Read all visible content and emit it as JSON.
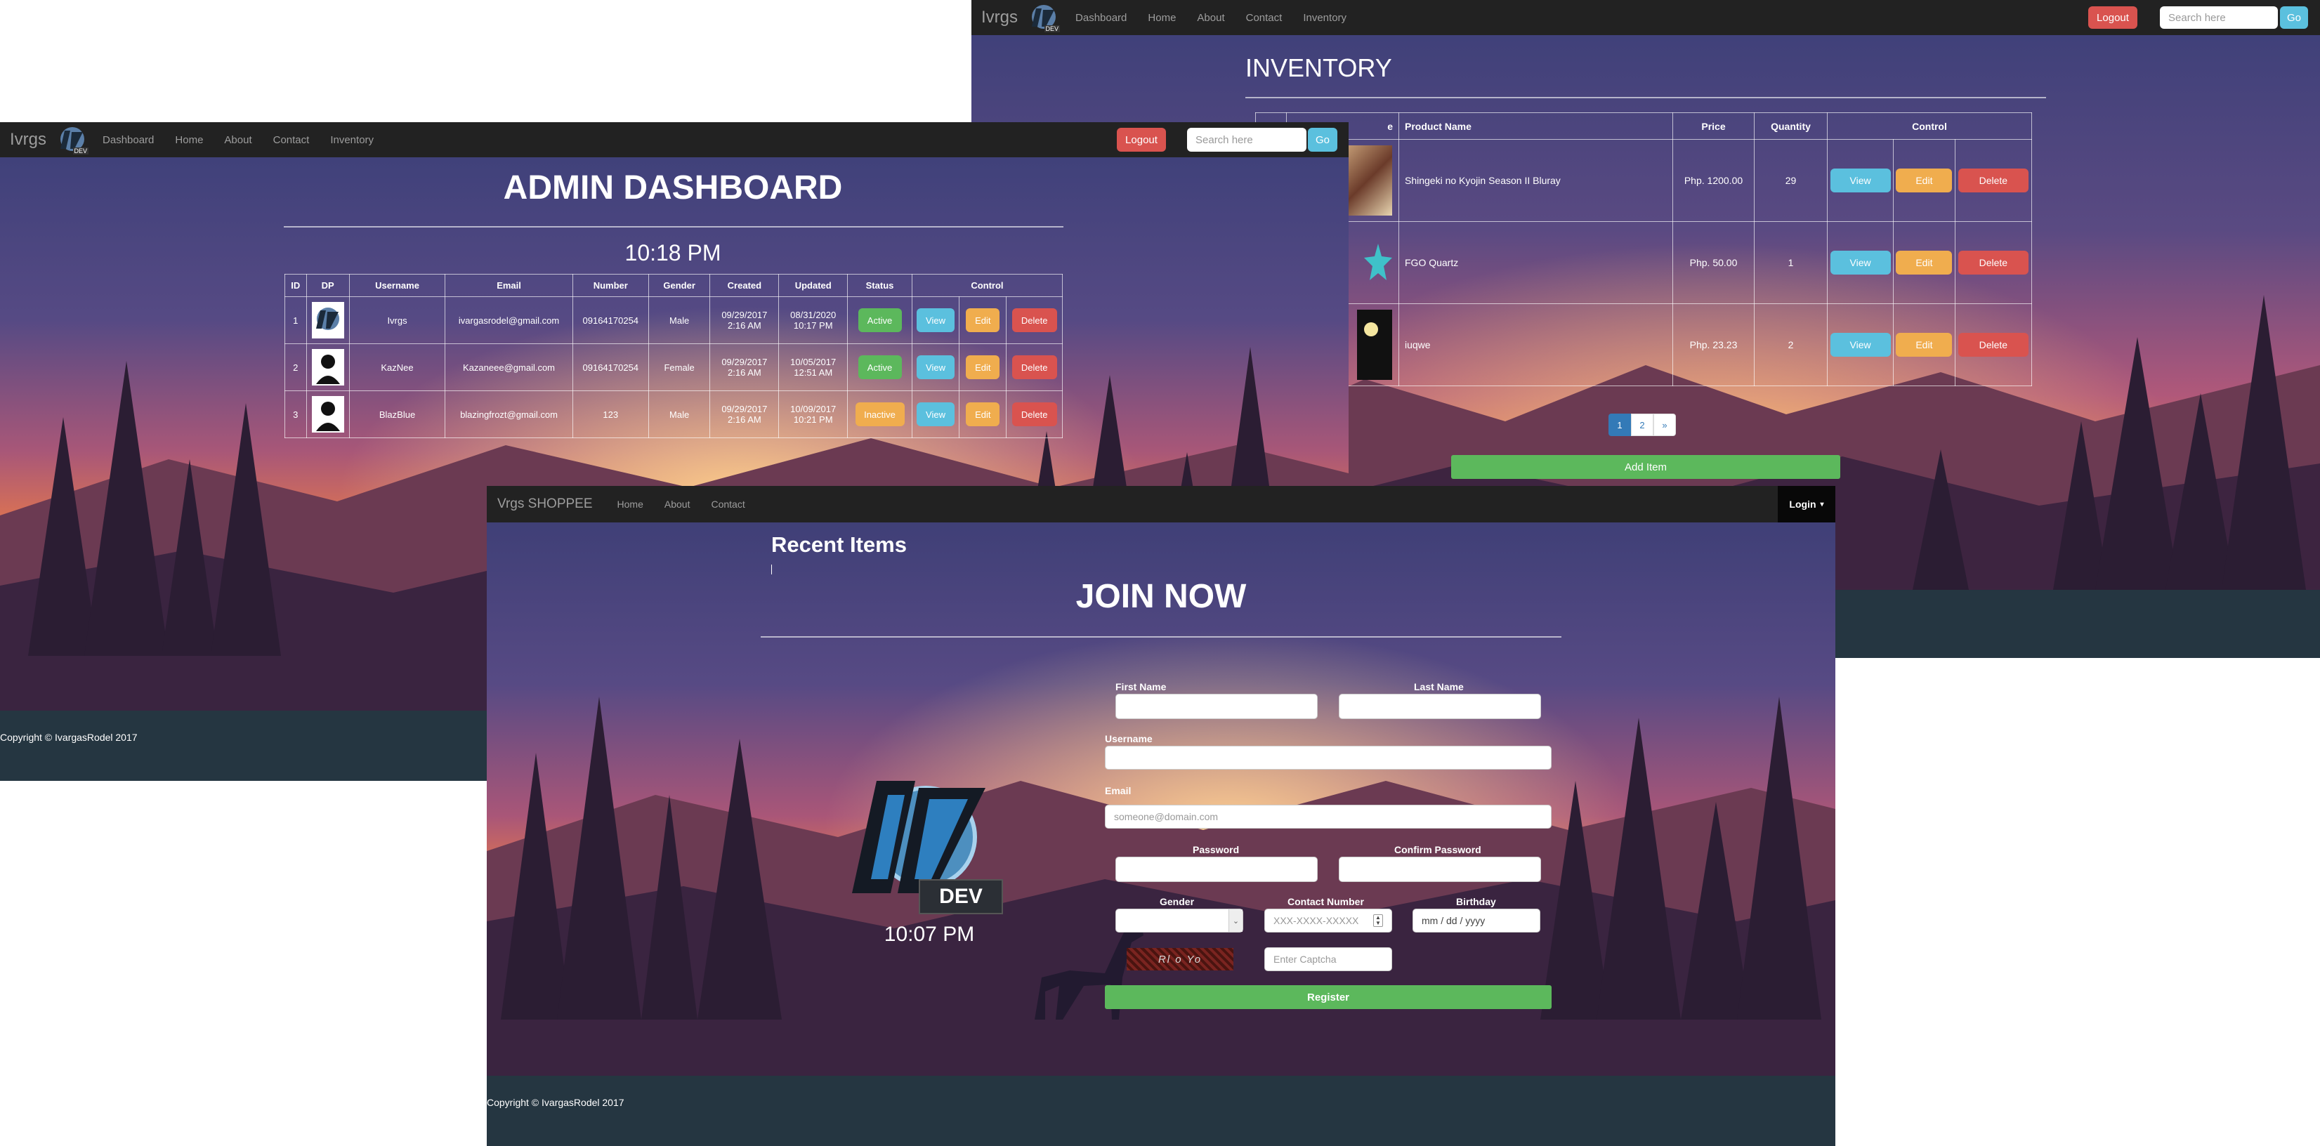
{
  "colors": {
    "navbar": "#222222",
    "footer": "#253641",
    "danger": "#d9534f",
    "info": "#5bc0de",
    "warning": "#f0ad4e",
    "success": "#5cb85c",
    "primary": "#337ab7"
  },
  "inventory_window": {
    "navbar": {
      "brand": "Ivrgs",
      "logo_text": "DEV",
      "links": [
        "Dashboard",
        "Home",
        "About",
        "Contact",
        "Inventory"
      ],
      "logout_label": "Logout",
      "search_placeholder": "Search here",
      "go_label": "Go"
    },
    "heading": "INVENTORY",
    "table": {
      "headers": [
        "",
        "e",
        "Product Name",
        "Price",
        "Quantity",
        "Control"
      ],
      "rows": [
        {
          "name": "Shingeki no Kyojin Season II Bluray",
          "price": "Php. 1200.00",
          "quantity": "29"
        },
        {
          "name": "FGO Quartz",
          "price": "Php. 50.00",
          "quantity": "1"
        },
        {
          "name": "iuqwe",
          "price": "Php. 23.23",
          "quantity": "2"
        }
      ],
      "view_label": "View",
      "edit_label": "Edit",
      "delete_label": "Delete"
    },
    "pagination": [
      "1",
      "2",
      "»"
    ],
    "add_item_label": "Add Item"
  },
  "admin_window": {
    "navbar": {
      "brand": "Ivrgs",
      "logo_text": "DEV",
      "links": [
        "Dashboard",
        "Home",
        "About",
        "Contact",
        "Inventory"
      ],
      "logout_label": "Logout",
      "search_placeholder": "Search here",
      "go_label": "Go"
    },
    "heading": "ADMIN DASHBOARD",
    "clock": "10:18 PM",
    "table": {
      "headers": [
        "ID",
        "DP",
        "Username",
        "Email",
        "Number",
        "Gender",
        "Created",
        "Updated",
        "Status",
        "Control"
      ],
      "rows": [
        {
          "id": "1",
          "username": "Ivrgs",
          "email": "ivargasrodel@gmail.com",
          "number": "09164170254",
          "gender": "Male",
          "created_date": "09/29/2017",
          "created_time": "2:16 AM",
          "updated_date": "08/31/2020",
          "updated_time": "10:17 PM",
          "status": "Active"
        },
        {
          "id": "2",
          "username": "KazNee",
          "email": "Kazaneee@gmail.com",
          "number": "09164170254",
          "gender": "Female",
          "created_date": "09/29/2017",
          "created_time": "2:16 AM",
          "updated_date": "10/05/2017",
          "updated_time": "12:51 AM",
          "status": "Active"
        },
        {
          "id": "3",
          "username": "BlazBlue",
          "email": "blazingfrozt@gmail.com",
          "number": "123",
          "gender": "Male",
          "created_date": "09/29/2017",
          "created_time": "2:16 AM",
          "updated_date": "10/09/2017",
          "updated_time": "10:21 PM",
          "status": "Inactive"
        }
      ],
      "view_label": "View",
      "edit_label": "Edit",
      "delete_label": "Delete"
    },
    "footer": "Copyright © IvargasRodel 2017"
  },
  "shop_window": {
    "navbar": {
      "brand": "Vrgs SHOPPEE",
      "links": [
        "Home",
        "About",
        "Contact"
      ],
      "login_label": "Login",
      "login_caret": "▾"
    },
    "recent_items": "Recent Items",
    "heading": "JOIN NOW",
    "logo_text": "DEV",
    "logo_letters": "IV",
    "clock": "10:07 PM",
    "form": {
      "first_name_label": "First Name",
      "last_name_label": "Last Name",
      "username_label": "Username",
      "email_label": "Email",
      "email_placeholder": "someone@domain.com",
      "password_label": "Password",
      "confirm_password_label": "Confirm Password",
      "gender_label": "Gender",
      "contact_label": "Contact Number",
      "contact_placeholder": "XXX-XXXX-XXXXX",
      "birthday_label": "Birthday",
      "birthday_placeholder": "mm / dd / yyyy",
      "captcha_text": "Rl o Yo",
      "captcha_placeholder": "Enter Captcha",
      "register_label": "Register"
    },
    "footer": "Copyright © IvargasRodel 2017"
  }
}
